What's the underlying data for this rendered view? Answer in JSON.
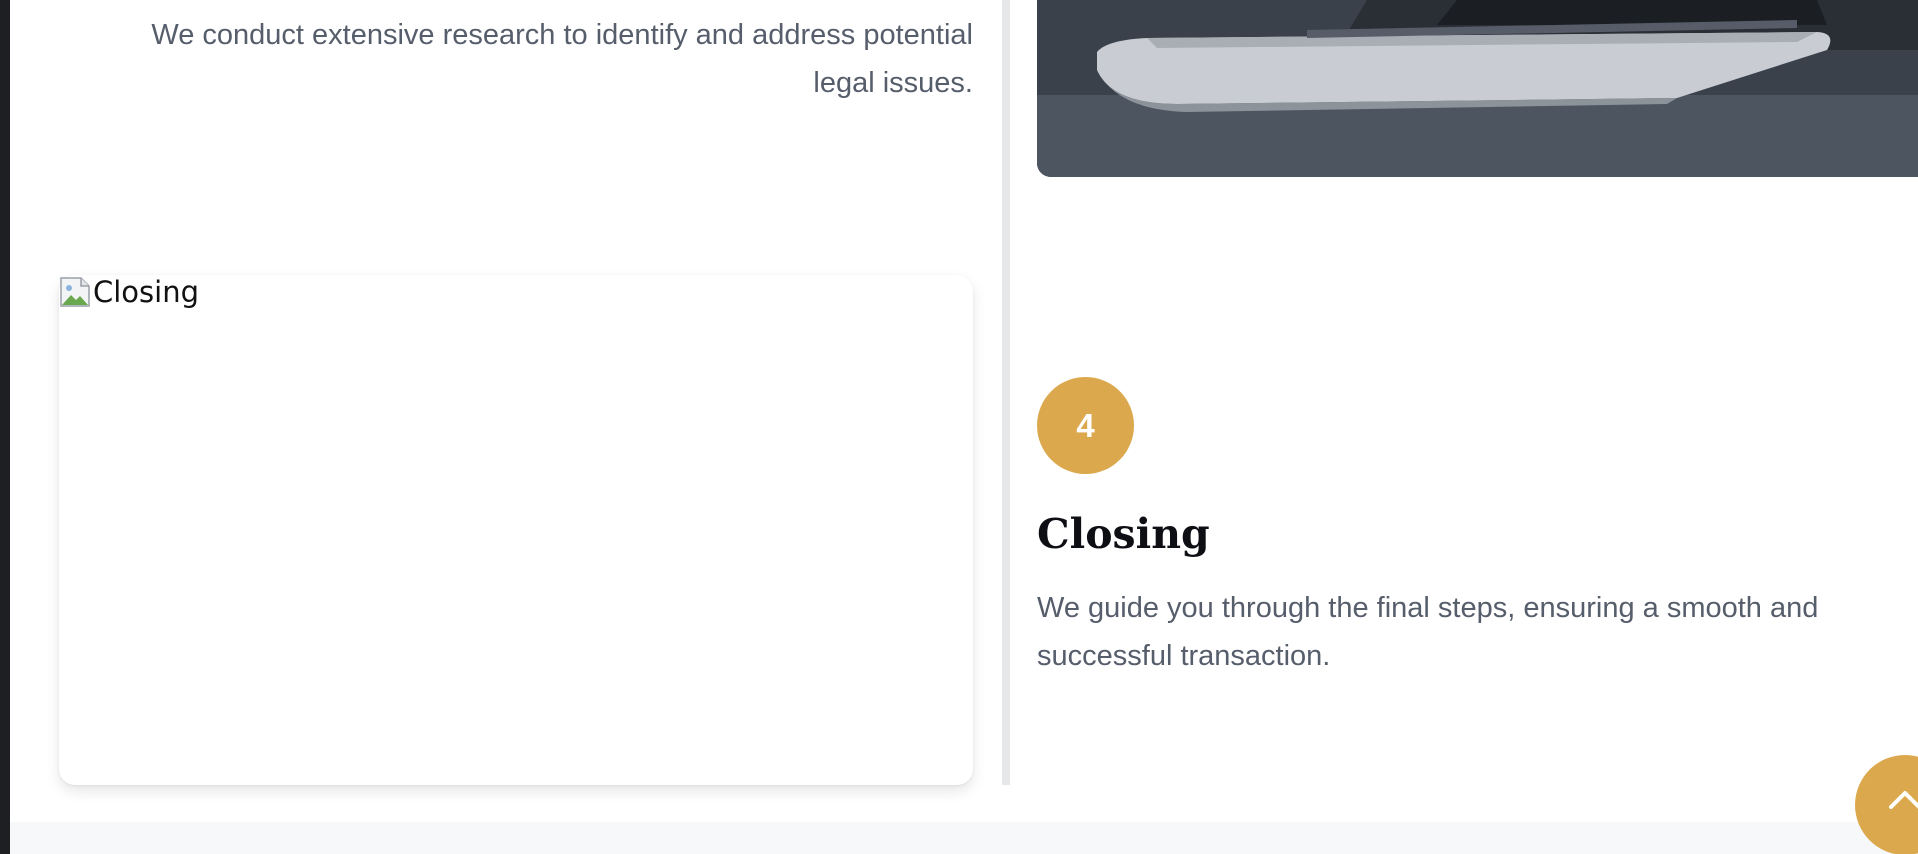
{
  "process": {
    "previous_step": {
      "description": "We conduct extensive research to identify and address potential legal issues.",
      "image_name": "laptop-photo"
    },
    "current_step": {
      "number": "4",
      "title": "Closing",
      "description": "We guide you through the final steps, ensuring a smooth and successful transaction.",
      "image_alt": "Closing"
    }
  },
  "ui": {
    "scroll_top_icon": "chevron-up-icon",
    "accent_color": "#dca84d",
    "text_color": "#565d6b",
    "heading_color": "#0d0f14"
  }
}
